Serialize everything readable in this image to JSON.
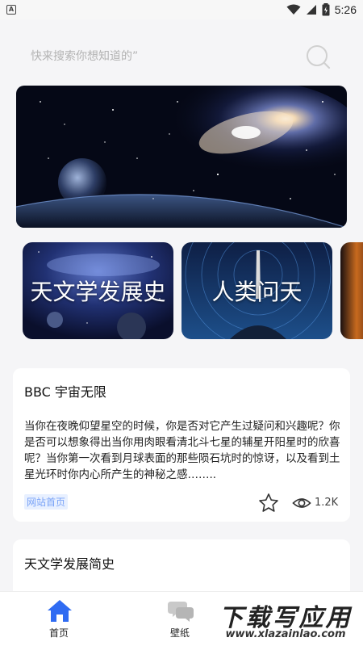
{
  "status_bar": {
    "time": "5:26"
  },
  "search": {
    "placeholder": "快来搜索你想知道的”"
  },
  "categories": [
    {
      "label": "天文学发展史"
    },
    {
      "label": "人类问天"
    }
  ],
  "articles": [
    {
      "title": "BBC 宇宙无限",
      "excerpt": "当你在夜晚仰望星空的时候，你是否对它产生过疑问和兴趣呢？你是否可以想象得出当你用肉眼看清北斗七星的辅星开阳星时的欣喜呢？当你第一次看到月球表面的那些陨石坑时的惊讶，以及看到土星光环时你内心所产生的神秘之感……..",
      "tag": "网站首页",
      "views": "1.2K"
    },
    {
      "title": "天文学发展简史"
    }
  ],
  "bottom_nav": [
    {
      "label": "首页",
      "icon": "home-icon",
      "active": true
    },
    {
      "label": "壁纸",
      "icon": "chat-bubbles-icon",
      "active": false
    }
  ],
  "watermark": {
    "text": "下载写应用",
    "url": "www.xlazainlao.com"
  },
  "colors": {
    "accent": "#2f6bf2",
    "tag_bg": "#e8f0ff",
    "tag_text": "#7aa3f7"
  }
}
